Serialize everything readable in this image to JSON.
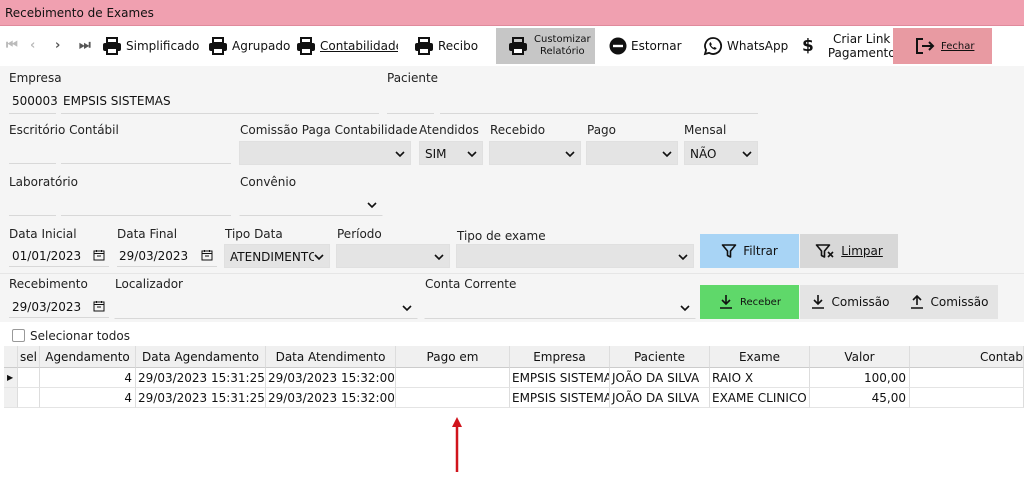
{
  "window": {
    "title": "Recebimento de Exames"
  },
  "toolbar": {
    "simplificado": "Simplificado",
    "agrupado": "Agrupado",
    "contabilidade": "Contabilidade",
    "recibo": "Recibo",
    "customizar_l1": "Customizar",
    "customizar_l2": "Relatório",
    "estornar": "Estornar",
    "whatsapp": "WhatsApp",
    "dollar": "$",
    "criar_l1": "Criar Link",
    "criar_l2": "Pagamento",
    "fechar": "Fechar"
  },
  "form": {
    "empresa_label": "Empresa",
    "empresa_code": "500003",
    "empresa_name": "EMPSIS SISTEMAS",
    "paciente_label": "Paciente",
    "escritorio_label": "Escritório Contábil",
    "comissao_label": "Comissão Paga Contabilidade",
    "atendidos_label": "Atendidos",
    "atendidos_value": "SIM",
    "recebido_label": "Recebido",
    "pago_label": "Pago",
    "mensal_label": "Mensal",
    "mensal_value": "NÃO",
    "laboratorio_label": "Laboratório",
    "convenio_label": "Convênio",
    "data_inicial_label": "Data Inicial",
    "data_inicial_value": "01/01/2023",
    "data_final_label": "Data Final",
    "data_final_value": "29/03/2023",
    "tipo_data_label": "Tipo Data",
    "tipo_data_value": "ATENDIMENTO",
    "periodo_label": "Período",
    "tipo_exame_label": "Tipo de exame",
    "filtrar": "Filtrar",
    "limpar": "Limpar",
    "recebimento_label": "Recebimento",
    "recebimento_value": "29/03/2023",
    "localizador_label": "Localizador",
    "conta_label": "Conta Corrente",
    "receber": "Receber",
    "comissao_down": "Comissão",
    "comissao_up": "Comissão"
  },
  "selecionar_todos": "Selecionar todos",
  "grid": {
    "columns": [
      "sel",
      "Agendamento",
      "Data Agendamento",
      "Data Atendimento",
      "Pago em",
      "Empresa",
      "Paciente",
      "Exame",
      "Valor",
      "Contab"
    ],
    "rows": [
      [
        "",
        "4",
        "29/03/2023 15:31:25",
        "29/03/2023 15:32:00",
        "",
        "EMPSIS SISTEMAS",
        "JOÃO DA SILVA",
        "RAIO X",
        "100,00",
        ""
      ],
      [
        "",
        "4",
        "29/03/2023 15:31:25",
        "29/03/2023 15:32:00",
        "",
        "EMPSIS SISTEMAS",
        "JOÃO DA SILVA",
        "EXAME CLINICO OCUPACIONAL",
        "45,00",
        ""
      ]
    ]
  },
  "colors": {
    "titlebar": "#f0a0b0",
    "filtrar": "#a8d4f5",
    "receber": "#5fd86a",
    "fechar": "#e89aa2",
    "arrow": "#d0141c"
  }
}
